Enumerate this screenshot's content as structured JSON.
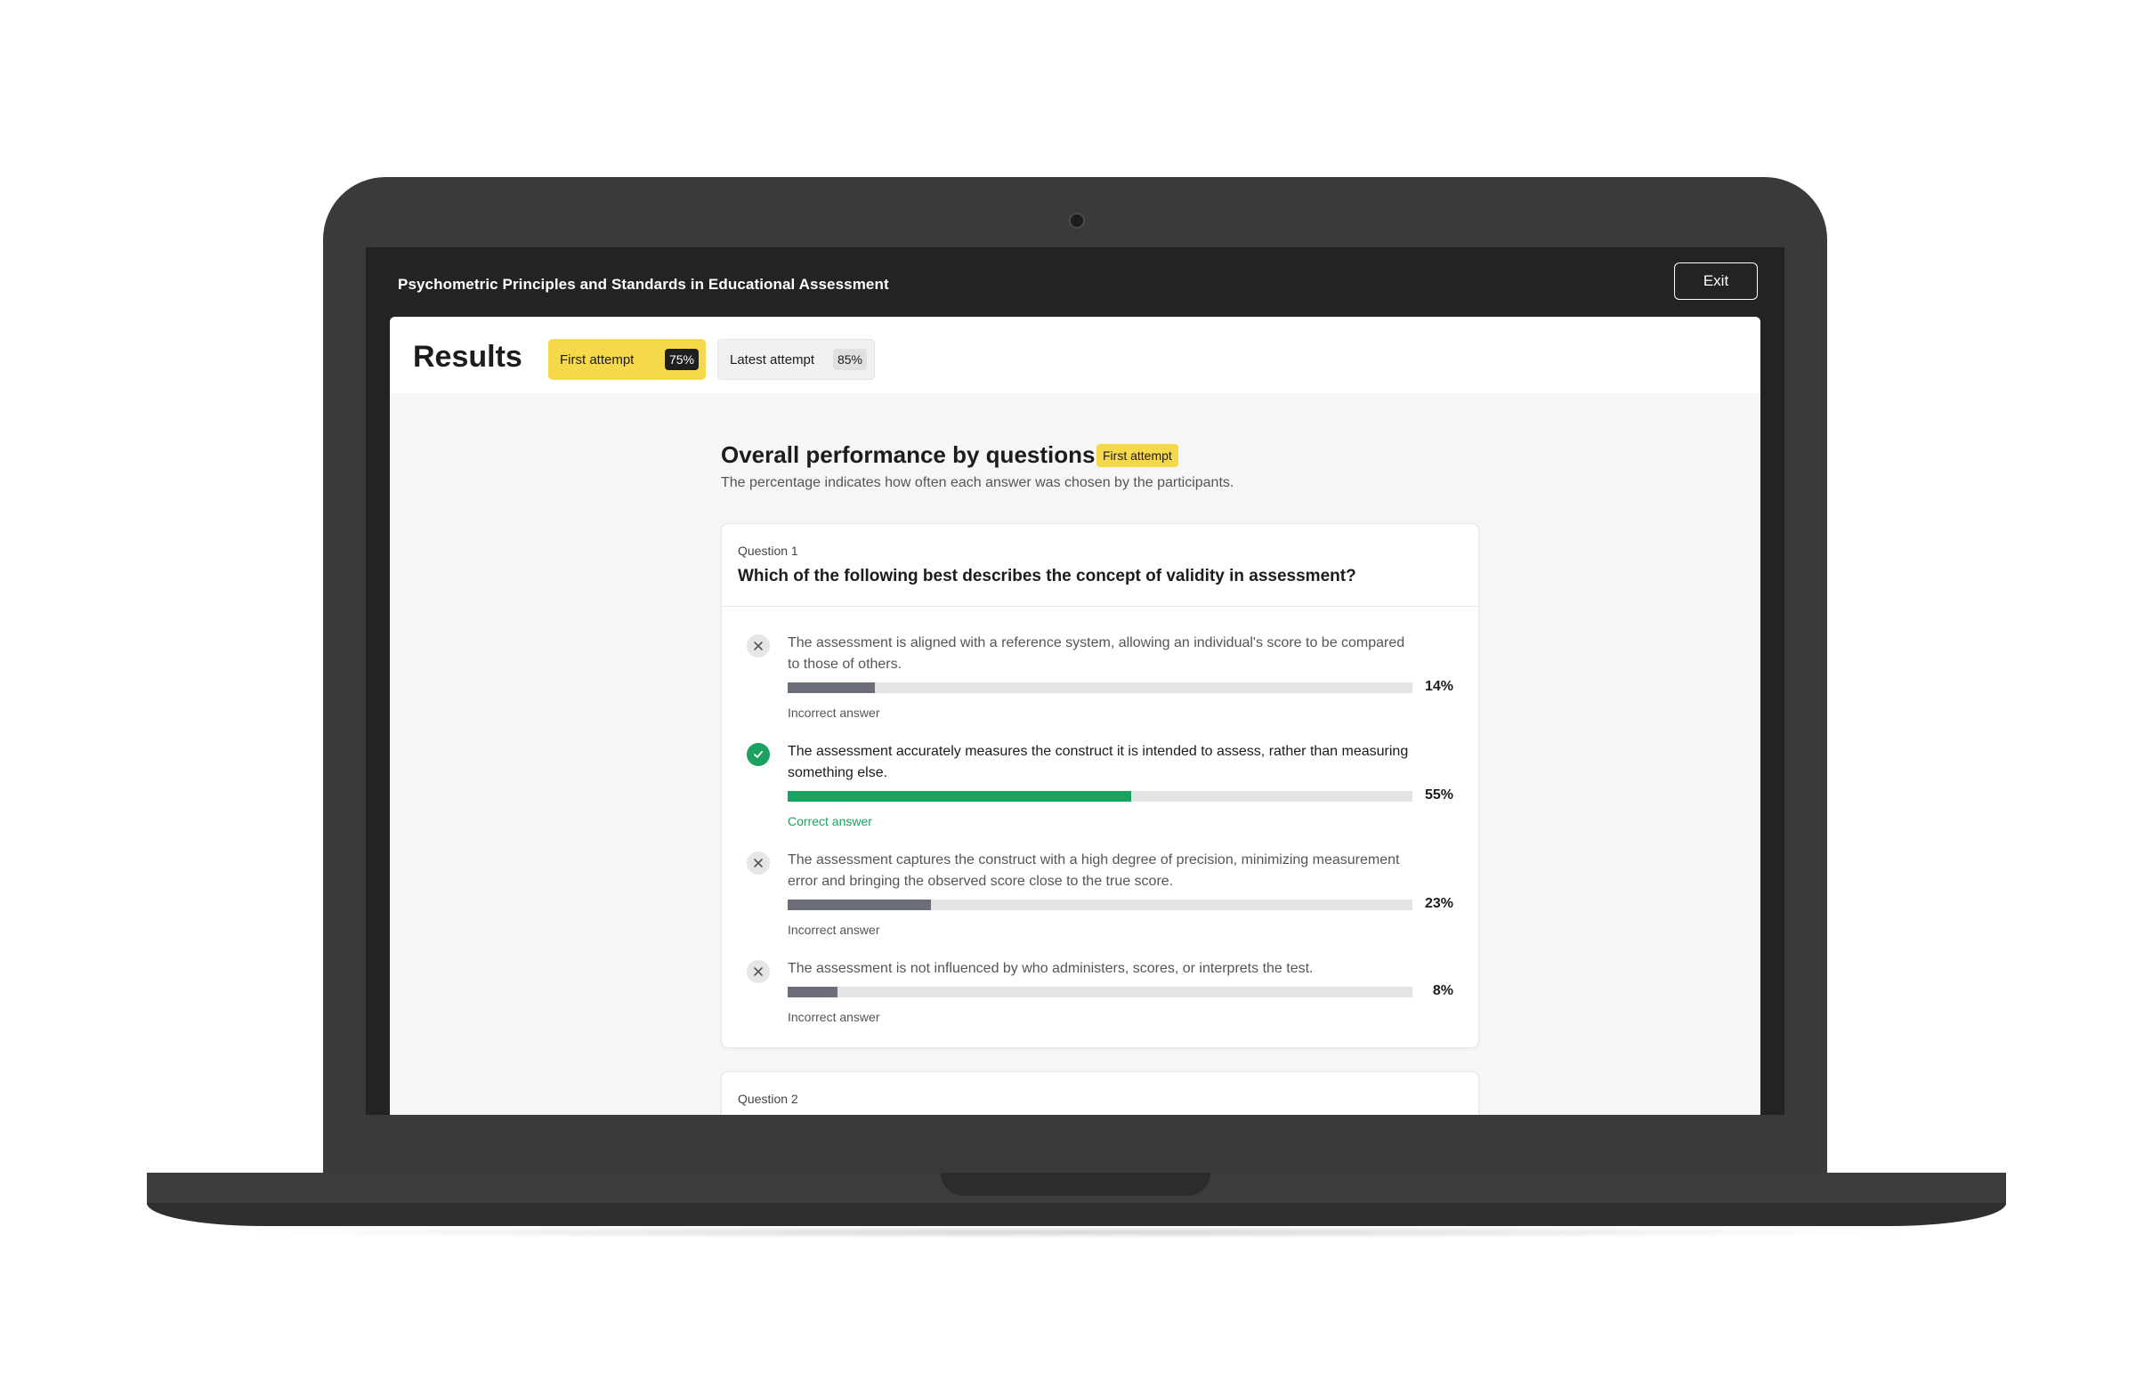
{
  "app": {
    "title": "Psychometric Principles and Standards in Educational Assessment",
    "exit_label": "Exit"
  },
  "results": {
    "title": "Results",
    "tabs": [
      {
        "label": "First attempt",
        "pct": "75%",
        "pct_value": 75,
        "active": true
      },
      {
        "label": "Latest attempt",
        "pct": "85%",
        "pct_value": 85,
        "active": false
      }
    ]
  },
  "section": {
    "title": "Overall performance by questions",
    "badge": "First attempt",
    "subtitle": "The percentage indicates how often each answer was chosen by the participants."
  },
  "questions": [
    {
      "number_label": "Question 1",
      "text": "Which of the following best describes the concept of validity in assessment?",
      "answers": [
        {
          "text": "The assessment is aligned with a reference system, allowing an individual's score to be compared to those of others.",
          "pct_label": "14%",
          "pct": 14,
          "correct": false,
          "status": "Incorrect answer",
          "icon": "x-icon"
        },
        {
          "text": "The assessment accurately measures the construct it is intended to assess, rather than measuring something else.",
          "pct_label": "55%",
          "pct": 55,
          "correct": true,
          "status": "Correct answer",
          "icon": "check-icon"
        },
        {
          "text": "The assessment captures the construct with a high degree of precision, minimizing measurement error and bringing the observed score close to the true score.",
          "pct_label": "23%",
          "pct": 23,
          "correct": false,
          "status": "Incorrect answer",
          "icon": "x-icon"
        },
        {
          "text": "The assessment is not influenced by who administers, scores, or interprets the test.",
          "pct_label": "8%",
          "pct": 8,
          "correct": false,
          "status": "Incorrect answer",
          "icon": "x-icon"
        }
      ]
    },
    {
      "number_label": "Question 2"
    }
  ],
  "colors": {
    "accent_yellow": "#f6d84b",
    "correct_green": "#1aa260",
    "incorrect_bar": "#6b6e78",
    "track": "#e4e4e6",
    "topbar": "#232323"
  }
}
